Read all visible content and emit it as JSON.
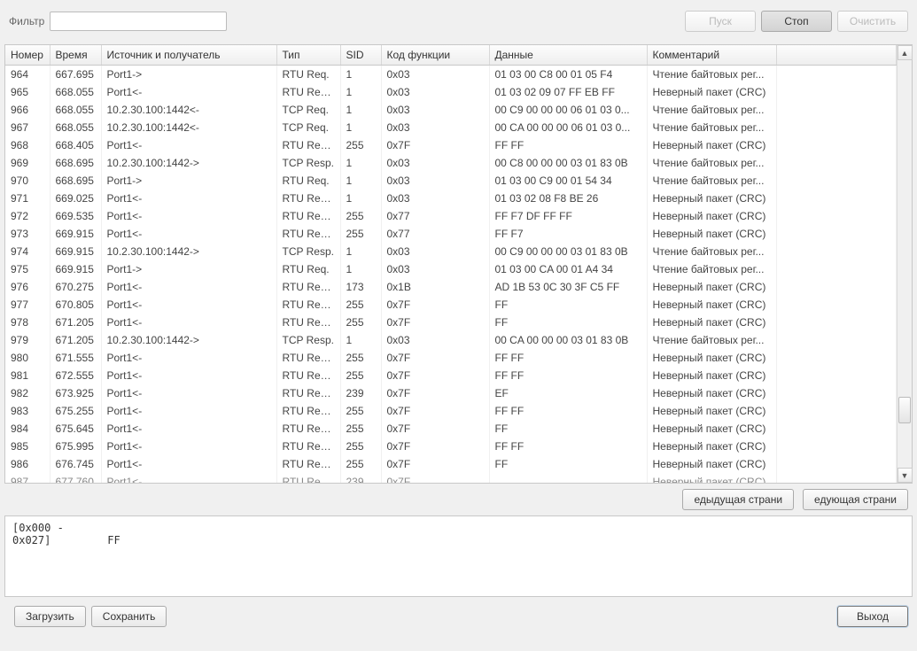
{
  "toolbar": {
    "filter_label": "Фильтр",
    "filter_value": "",
    "start_label": "Пуск",
    "stop_label": "Стоп",
    "clear_label": "Очистить"
  },
  "columns": {
    "num": "Номер",
    "time": "Время",
    "src": "Источник и получатель",
    "type": "Тип",
    "sid": "SID",
    "func": "Код функции",
    "data": "Данные",
    "comment": "Комментарий",
    "extra": ""
  },
  "rows": [
    {
      "num": "964",
      "time": "667.695",
      "src": "Port1->",
      "type": "RTU Req.",
      "sid": "1",
      "func": "0x03",
      "data": "01 03 00 C8 00 01 05 F4",
      "comment": "Чтение байтовых рег..."
    },
    {
      "num": "965",
      "time": "668.055",
      "src": "Port1<-",
      "type": "RTU Resp.",
      "sid": "1",
      "func": "0x03",
      "data": "01 03 02 09 07 FF EB FF",
      "comment": "Неверный пакет (CRC)"
    },
    {
      "num": "966",
      "time": "668.055",
      "src": "10.2.30.100:1442<-",
      "type": "TCP Req.",
      "sid": "1",
      "func": "0x03",
      "data": "00 C9 00 00 00 06 01 03 0...",
      "comment": "Чтение байтовых рег..."
    },
    {
      "num": "967",
      "time": "668.055",
      "src": "10.2.30.100:1442<-",
      "type": "TCP Req.",
      "sid": "1",
      "func": "0x03",
      "data": "00 CA 00 00 00 06 01 03 0...",
      "comment": "Чтение байтовых рег..."
    },
    {
      "num": "968",
      "time": "668.405",
      "src": "Port1<-",
      "type": "RTU Resp.",
      "sid": "255",
      "func": "0x7F",
      "data": "FF FF",
      "comment": "Неверный пакет (CRC)"
    },
    {
      "num": "969",
      "time": "668.695",
      "src": "10.2.30.100:1442->",
      "type": "TCP Resp.",
      "sid": "1",
      "func": "0x03",
      "data": "00 C8 00 00 00 03 01 83 0B",
      "comment": "Чтение байтовых рег..."
    },
    {
      "num": "970",
      "time": "668.695",
      "src": "Port1->",
      "type": "RTU Req.",
      "sid": "1",
      "func": "0x03",
      "data": "01 03 00 C9 00 01 54 34",
      "comment": "Чтение байтовых рег..."
    },
    {
      "num": "971",
      "time": "669.025",
      "src": "Port1<-",
      "type": "RTU Resp.",
      "sid": "1",
      "func": "0x03",
      "data": "01 03 02 08 F8 BE 26",
      "comment": "Неверный пакет (CRC)"
    },
    {
      "num": "972",
      "time": "669.535",
      "src": "Port1<-",
      "type": "RTU Resp.",
      "sid": "255",
      "func": "0x77",
      "data": "FF F7 DF FF FF",
      "comment": "Неверный пакет (CRC)"
    },
    {
      "num": "973",
      "time": "669.915",
      "src": "Port1<-",
      "type": "RTU Resp.",
      "sid": "255",
      "func": "0x77",
      "data": "FF F7",
      "comment": "Неверный пакет (CRC)"
    },
    {
      "num": "974",
      "time": "669.915",
      "src": "10.2.30.100:1442->",
      "type": "TCP Resp.",
      "sid": "1",
      "func": "0x03",
      "data": "00 C9 00 00 00 03 01 83 0B",
      "comment": "Чтение байтовых рег..."
    },
    {
      "num": "975",
      "time": "669.915",
      "src": "Port1->",
      "type": "RTU Req.",
      "sid": "1",
      "func": "0x03",
      "data": "01 03 00 CA 00 01 A4 34",
      "comment": "Чтение байтовых рег..."
    },
    {
      "num": "976",
      "time": "670.275",
      "src": "Port1<-",
      "type": "RTU Resp.",
      "sid": "173",
      "func": "0x1B",
      "data": "AD 1B 53 0C 30 3F C5 FF",
      "comment": "Неверный пакет (CRC)"
    },
    {
      "num": "977",
      "time": "670.805",
      "src": "Port1<-",
      "type": "RTU Resp.",
      "sid": "255",
      "func": "0x7F",
      "data": "FF",
      "comment": "Неверный пакет (CRC)"
    },
    {
      "num": "978",
      "time": "671.205",
      "src": "Port1<-",
      "type": "RTU Resp.",
      "sid": "255",
      "func": "0x7F",
      "data": "FF",
      "comment": "Неверный пакет (CRC)"
    },
    {
      "num": "979",
      "time": "671.205",
      "src": "10.2.30.100:1442->",
      "type": "TCP Resp.",
      "sid": "1",
      "func": "0x03",
      "data": "00 CA 00 00 00 03 01 83 0B",
      "comment": "Чтение байтовых рег..."
    },
    {
      "num": "980",
      "time": "671.555",
      "src": "Port1<-",
      "type": "RTU Resp.",
      "sid": "255",
      "func": "0x7F",
      "data": "FF FF",
      "comment": "Неверный пакет (CRC)"
    },
    {
      "num": "981",
      "time": "672.555",
      "src": "Port1<-",
      "type": "RTU Resp.",
      "sid": "255",
      "func": "0x7F",
      "data": "FF FF",
      "comment": "Неверный пакет (CRC)"
    },
    {
      "num": "982",
      "time": "673.925",
      "src": "Port1<-",
      "type": "RTU Resp.",
      "sid": "239",
      "func": "0x7F",
      "data": "EF",
      "comment": "Неверный пакет (CRC)"
    },
    {
      "num": "983",
      "time": "675.255",
      "src": "Port1<-",
      "type": "RTU Resp.",
      "sid": "255",
      "func": "0x7F",
      "data": "FF FF",
      "comment": "Неверный пакет (CRC)"
    },
    {
      "num": "984",
      "time": "675.645",
      "src": "Port1<-",
      "type": "RTU Resp.",
      "sid": "255",
      "func": "0x7F",
      "data": "FF",
      "comment": "Неверный пакет (CRC)"
    },
    {
      "num": "985",
      "time": "675.995",
      "src": "Port1<-",
      "type": "RTU Resp.",
      "sid": "255",
      "func": "0x7F",
      "data": "FF FF",
      "comment": "Неверный пакет (CRC)"
    },
    {
      "num": "986",
      "time": "676.745",
      "src": "Port1<-",
      "type": "RTU Resp.",
      "sid": "255",
      "func": "0x7F",
      "data": "FF",
      "comment": "Неверный пакет (CRC)"
    }
  ],
  "partial_row": {
    "num": "987",
    "time": "677.760",
    "src": "Port1<-",
    "type": "RTU Resp.",
    "sid": "239",
    "func": "0x7F",
    "data": "",
    "comment": "Неверный пакет (CRC)"
  },
  "pager": {
    "prev_label": "едыдущая страни",
    "next_label": "едующая страни"
  },
  "hex": {
    "range": "[0x000 - 0x027]",
    "bytes": "FF"
  },
  "footer": {
    "load_label": "Загрузить",
    "save_label": "Сохранить",
    "exit_label": "Выход"
  }
}
